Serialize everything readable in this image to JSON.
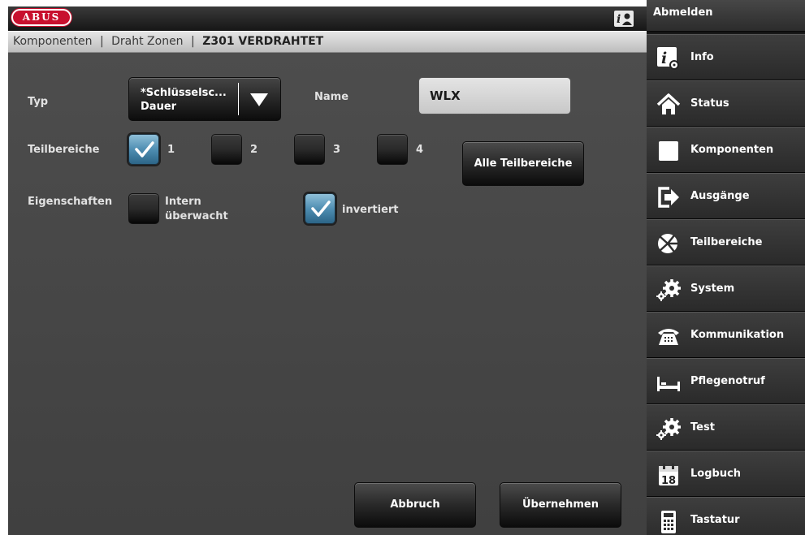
{
  "header": {
    "logo_text": "ABUS",
    "info_icon": "info-user-icon"
  },
  "breadcrumb": {
    "crumbs": [
      "Komponenten",
      "Draht Zonen"
    ],
    "separator": "|",
    "current": "Z301 VERDRAHTET"
  },
  "form": {
    "typ_label": "Typ",
    "typ_value_line1": "*Schlüsselsc...",
    "typ_value_line2": "Dauer",
    "name_label": "Name",
    "name_value": "WLX",
    "teilbereiche_label": "Teilbereiche",
    "teilbereiche": [
      {
        "label": "1",
        "checked": true
      },
      {
        "label": "2",
        "checked": false
      },
      {
        "label": "3",
        "checked": false
      },
      {
        "label": "4",
        "checked": false
      }
    ],
    "alle_teilbereiche_label": "Alle Teilbereiche",
    "eigenschaften_label": "Eigenschaften",
    "intern_line1": "Intern",
    "intern_line2": "überwacht",
    "intern_checked": false,
    "invertiert_label": "invertiert",
    "invertiert_checked": true
  },
  "actions": {
    "cancel_label": "Abbruch",
    "apply_label": "Übernehmen"
  },
  "sidebar": {
    "logout_label": "Abmelden",
    "items": [
      {
        "label": "Info",
        "icon": "info-icon"
      },
      {
        "label": "Status",
        "icon": "home-icon"
      },
      {
        "label": "Komponenten",
        "icon": "component-square-icon"
      },
      {
        "label": "Ausgänge",
        "icon": "output-arrow-icon"
      },
      {
        "label": "Teilbereiche",
        "icon": "partitions-pie-icon"
      },
      {
        "label": "System",
        "icon": "gears-icon"
      },
      {
        "label": "Kommunikation",
        "icon": "telephone-icon"
      },
      {
        "label": "Pflegenotruf",
        "icon": "bed-icon"
      },
      {
        "label": "Test",
        "icon": "gears-icon"
      },
      {
        "label": "Logbuch",
        "icon": "calendar-18-icon"
      },
      {
        "label": "Tastatur",
        "icon": "keypad-icon"
      }
    ]
  },
  "colors": {
    "brand_red": "#c8102e",
    "checkbox_checked": "#4f8eb2",
    "content_bg": "#4a4a4a",
    "sidebar_bg": "#2f2f2f"
  }
}
